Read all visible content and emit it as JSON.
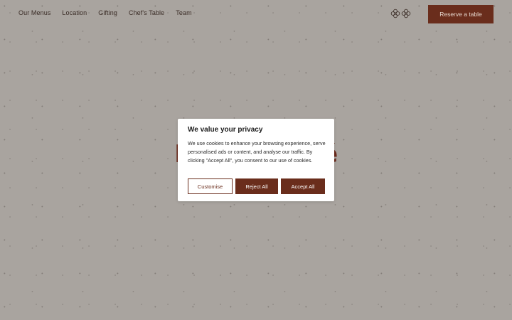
{
  "nav": {
    "items": [
      "Our Menus",
      "Location",
      "Gifting",
      "Chef's Table",
      "Team"
    ],
    "logo_icon": "two-flower-icon",
    "reserve_label": "Reserve a table"
  },
  "hero": {
    "title": "Bonjour Abé"
  },
  "cookie": {
    "title": "We value your privacy",
    "body": "We use cookies to enhance your browsing experience, serve personalised ads or content, and analyse our traffic. By clicking \"Accept All\", you consent to our use of cookies.",
    "customise_label": "Customise",
    "reject_label": "Reject All",
    "accept_label": "Accept All"
  },
  "colors": {
    "background": "#a9a49f",
    "brand": "#6a2d1c",
    "dialog": "#ffffff"
  }
}
